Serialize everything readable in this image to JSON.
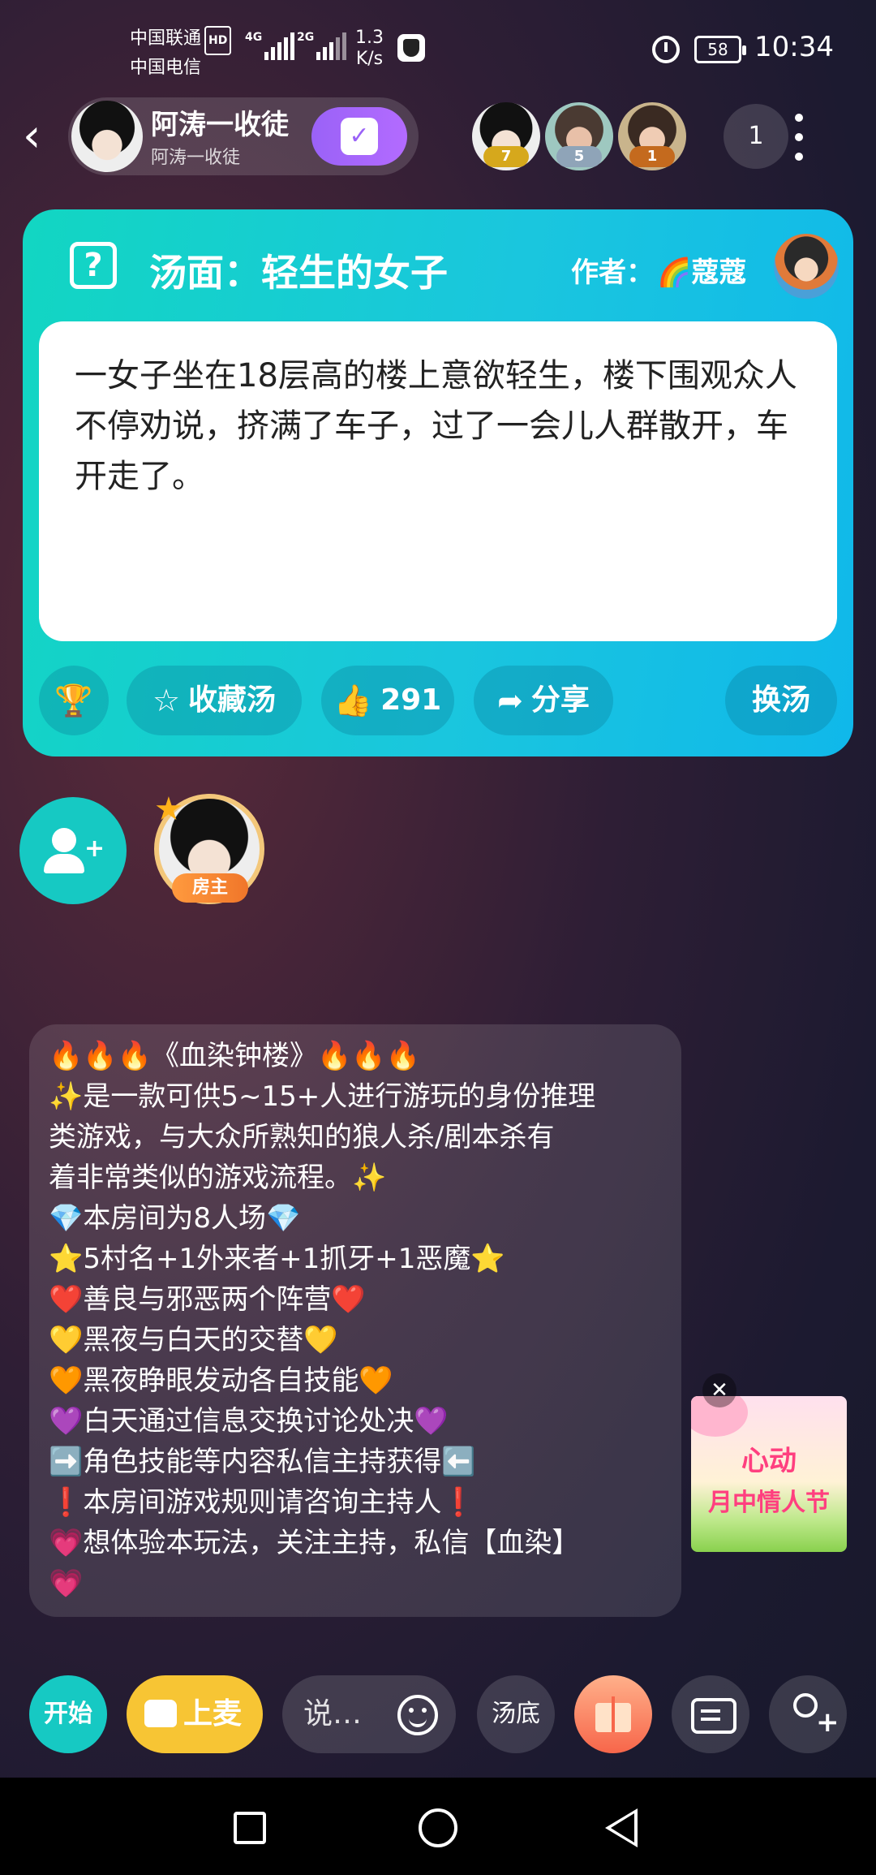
{
  "status_bar": {
    "carrier1": "中国联通",
    "carrier1_badge": "HD",
    "carrier2": "中国电信",
    "net1": "4G",
    "net2": "2G",
    "speed_value": "1.3",
    "speed_unit": "K/s",
    "battery": "58",
    "time": "10:34"
  },
  "header": {
    "host_name": "阿涛一收徒",
    "host_subtitle": "阿涛一收徒",
    "checkin_icon": "✓",
    "audience_levels": [
      "7",
      "5",
      "1"
    ],
    "online_count": "1"
  },
  "soup_card": {
    "title": "汤面：轻生的女子",
    "author_label": "作者：",
    "author_name": "🌈蔻蔻",
    "question_icon": "?",
    "body": "一女子坐在18层高的楼上意欲轻生，楼下围观众人不停劝说，挤满了车子，过了一会儿人群散开，车开走了。",
    "actions": {
      "favorite": "收藏汤",
      "likes": "291",
      "share": "分享",
      "change": "换汤"
    }
  },
  "seats": {
    "owner_tag": "房主"
  },
  "rules": [
    "🔥🔥🔥《血染钟楼》🔥🔥🔥",
    "✨是一款可供5~15+人进行游玩的身份推理",
    "类游戏，与大众所熟知的狼人杀/剧本杀有",
    "着非常类似的游戏流程。✨",
    "💎本房间为8人场💎",
    "⭐5村名+1外来者+1抓牙+1恶魔⭐",
    "❤️善良与邪恶两个阵营❤️",
    "💛黑夜与白天的交替💛",
    "🧡黑夜睁眼发动各自技能🧡",
    "💜白天通过信息交换讨论处决💜",
    "➡️角色技能等内容私信主持获得⬅️",
    "❗本房间游戏规则请咨询主持人❗",
    "💗想体验本玩法，关注主持，私信【血染】",
    "💗"
  ],
  "promo": {
    "line1": "心动",
    "line2": "月中情人节",
    "close": "✕"
  },
  "bottom_bar": {
    "start": "开始",
    "mic": "上麦",
    "say_placeholder": "说…",
    "soup_bottom": "汤底"
  },
  "colors": {
    "card_teal": "#12d6c2",
    "card_blue": "#10b8ea",
    "checkin_purple": "#9a62f7",
    "mic_yellow": "#f7c534",
    "invite_teal": "#16c9c3"
  }
}
